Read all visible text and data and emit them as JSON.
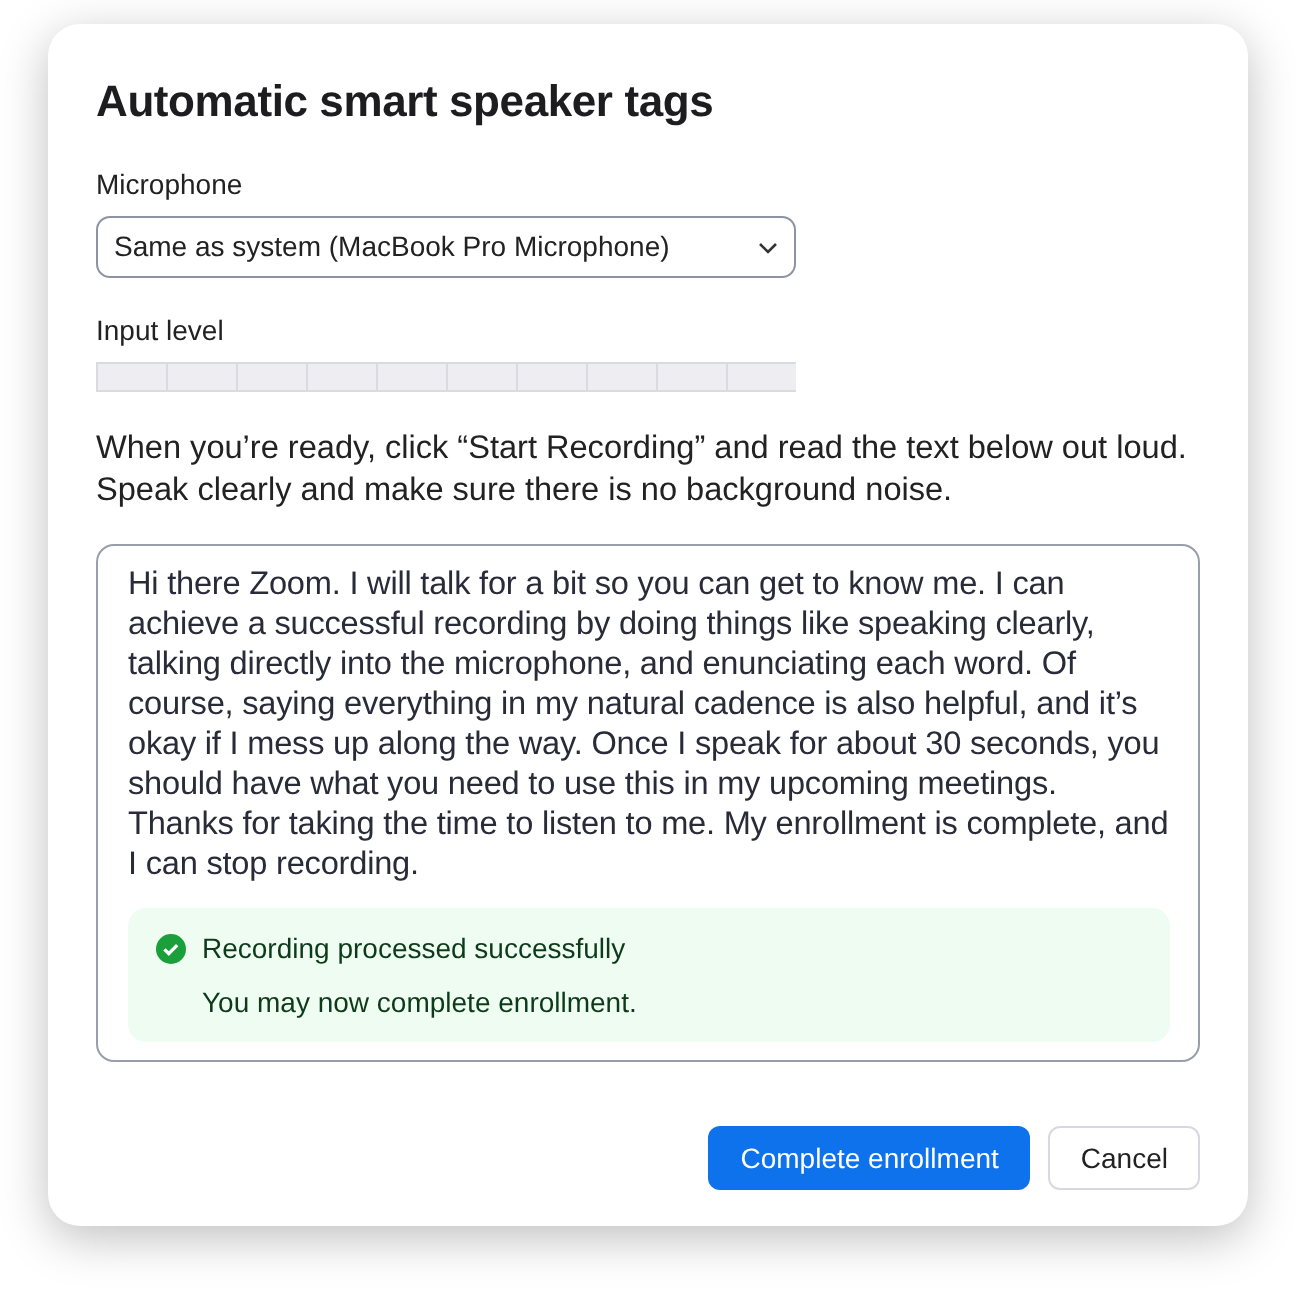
{
  "dialog": {
    "title": "Automatic smart speaker tags",
    "microphone": {
      "label": "Microphone",
      "value": "Same as system (MacBook Pro Microphone)"
    },
    "input_level": {
      "label": "Input level"
    },
    "instructions": "When you’re ready, click “Start Recording” and read the text below out loud. Speak clearly and make sure there is no background noise.",
    "passage": "Hi there Zoom. I will talk for a bit so you can get to know me. I can achieve a successful recording by doing things like speaking clearly, talking directly into the microphone, and enunciating each word. Of course, saying everything in my natural cadence is also helpful, and it’s okay if I mess up along the way. Once I speak for about 30 seconds, you should have what you need to use this in my upcoming meetings. Thanks for taking the time to listen to me. My enrollment is complete, and I can stop recording.",
    "status": {
      "kind": "success",
      "title": "Recording processed successfully",
      "message": "You may now complete enrollment."
    },
    "buttons": [
      {
        "label": "Complete enrollment",
        "kind": "primary"
      },
      {
        "label": "Cancel",
        "kind": "secondary"
      }
    ]
  }
}
